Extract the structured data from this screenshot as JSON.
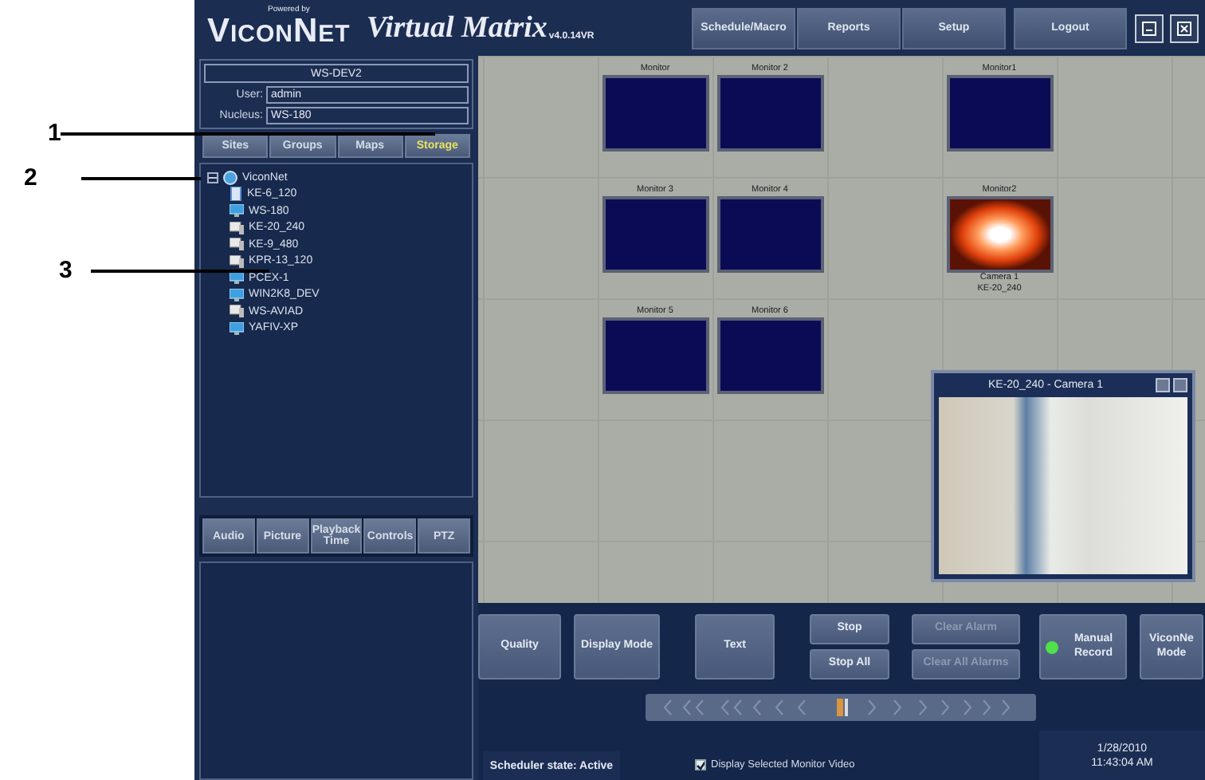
{
  "callouts": [
    {
      "label": "1"
    },
    {
      "label": "2"
    },
    {
      "label": "3"
    }
  ],
  "header": {
    "powered_by": "Powered by",
    "logo": "ViconNet",
    "title": "Virtual Matrix",
    "version": "v4.0.14VR",
    "nav": [
      {
        "label": "Schedule/Macro",
        "kind": "page"
      },
      {
        "label": "Reports",
        "kind": "page"
      },
      {
        "label": "Setup",
        "kind": "page"
      },
      {
        "label": "Logout",
        "kind": "session"
      }
    ]
  },
  "session": {
    "workstation": "WS-DEV2",
    "fields": [
      {
        "label": "User:",
        "value": "admin"
      },
      {
        "label": "Nucleus:",
        "value": "WS-180"
      }
    ]
  },
  "tabs": [
    {
      "label": "Sites",
      "selected": false
    },
    {
      "label": "Groups",
      "selected": false
    },
    {
      "label": "Maps",
      "selected": false
    },
    {
      "label": "Storage",
      "selected": true
    }
  ],
  "tree": {
    "label": "ViconNet",
    "expanded": true,
    "children": [
      {
        "label": "KE-6_120",
        "kind": "tower"
      },
      {
        "label": "WS-180",
        "kind": "workstation"
      },
      {
        "label": "KE-20_240",
        "kind": "unit"
      },
      {
        "label": "KE-9_480",
        "kind": "unit"
      },
      {
        "label": "KPR-13_120",
        "kind": "unit"
      },
      {
        "label": "PCEX-1",
        "kind": "workstation"
      },
      {
        "label": "WIN2K8_DEV",
        "kind": "workstation"
      },
      {
        "label": "WS-AVIAD",
        "kind": "unit"
      },
      {
        "label": "YAFIV-XP",
        "kind": "workstation"
      }
    ]
  },
  "lower_tabs": [
    {
      "label": "Audio"
    },
    {
      "label": "Picture"
    },
    {
      "label": "Playback Time"
    },
    {
      "label": "Controls"
    },
    {
      "label": "PTZ"
    }
  ],
  "monitor_grid": {
    "rows": [
      {
        "cells": [
          {
            "kind": "empty"
          },
          {
            "kind": "idle",
            "label": "Monitor"
          },
          {
            "kind": "idle",
            "label": "Monitor 2"
          },
          {
            "kind": "empty"
          },
          {
            "kind": "idle",
            "label": "Monitor1"
          },
          {
            "kind": "empty"
          }
        ]
      },
      {
        "cells": [
          {
            "kind": "empty"
          },
          {
            "kind": "idle",
            "label": "Monitor 3"
          },
          {
            "kind": "idle",
            "label": "Monitor 4"
          },
          {
            "kind": "empty"
          },
          {
            "kind": "live",
            "label": "Monitor2",
            "camera": "Camera 1",
            "unit": "KE-20_240"
          },
          {
            "kind": "empty"
          }
        ]
      },
      {
        "cells": [
          {
            "kind": "empty"
          },
          {
            "kind": "idle",
            "label": "Monitor 5"
          },
          {
            "kind": "idle",
            "label": "Monitor 6"
          },
          {
            "kind": "empty"
          },
          {
            "kind": "empty"
          },
          {
            "kind": "empty"
          }
        ]
      }
    ]
  },
  "video_window": {
    "title": "KE-20_240 - Camera 1"
  },
  "controls": [
    {
      "kind": "single",
      "label": "Quality"
    },
    {
      "kind": "single",
      "label": "Display Mode"
    },
    {
      "kind": "single",
      "label": "Text"
    },
    {
      "kind": "stack",
      "items": [
        {
          "label": "Stop",
          "disabled": false
        },
        {
          "label": "Stop All",
          "disabled": false
        }
      ]
    },
    {
      "kind": "stack",
      "items": [
        {
          "label": "Clear Alarm",
          "disabled": true
        },
        {
          "label": "Clear All Alarms",
          "disabled": true
        }
      ]
    },
    {
      "kind": "record",
      "label": "Manual Record",
      "on": true
    },
    {
      "kind": "single",
      "label": "ViconNe Mode"
    }
  ],
  "status": {
    "scheduler": "Scheduler state: Active",
    "display_selected": {
      "label": "Display Selected Monitor Video",
      "checked": true
    },
    "date": "1/28/2010",
    "time": "11:43:04 AM"
  }
}
